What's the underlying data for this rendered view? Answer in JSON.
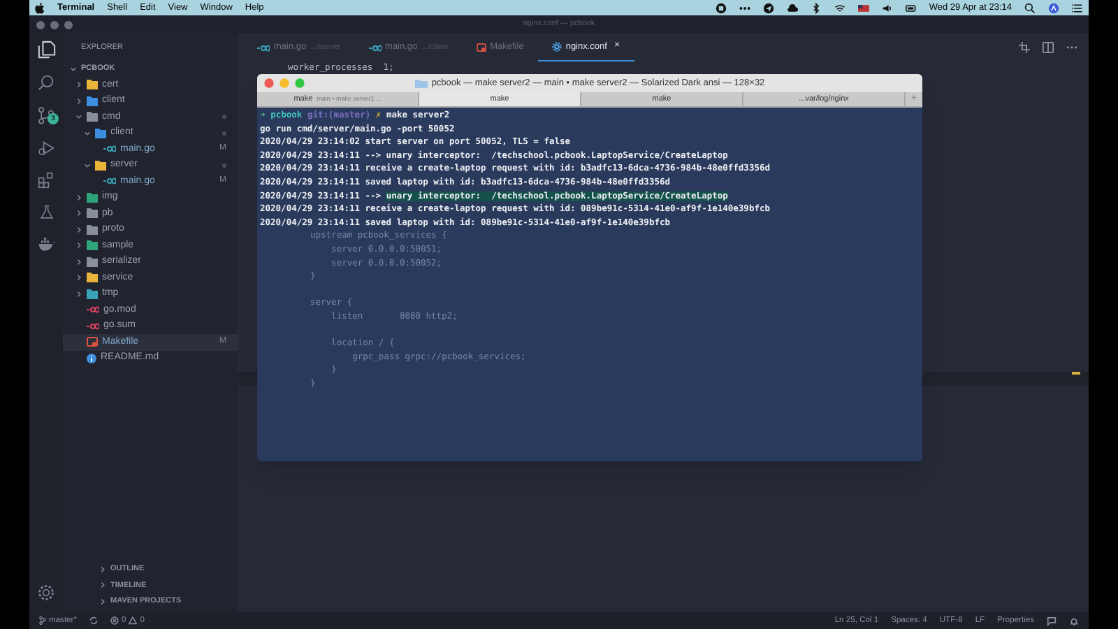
{
  "menu_bar": {
    "app": "Terminal",
    "items": [
      "Shell",
      "Edit",
      "View",
      "Window",
      "Help"
    ],
    "clock": "Wed 29 Apr at 23:14"
  },
  "window": {
    "title": "nginx.conf — pcbook"
  },
  "activity_bar": {
    "source_control_badge": "3"
  },
  "sidebar": {
    "title": "EXPLORER",
    "project": "PCBOOK",
    "tree": [
      {
        "label": "cert",
        "kind": "folder",
        "color": "#e8b43a",
        "expanded": false,
        "selected": false
      },
      {
        "label": "client",
        "kind": "folder",
        "color": "#3d8ee0",
        "expanded": false,
        "selected": false
      },
      {
        "label": "cmd",
        "kind": "folder",
        "color": "#8a8f9c",
        "expanded": true,
        "dot": true,
        "selected": false,
        "children": [
          {
            "label": "client",
            "kind": "folder",
            "color": "#3d8ee0",
            "expanded": true,
            "dot": true,
            "selected": false,
            "children": [
              {
                "label": "main.go",
                "kind": "go",
                "color": "#3aa3b8",
                "modified": "M",
                "selected": false
              }
            ]
          },
          {
            "label": "server",
            "kind": "folder",
            "color": "#e8b43a",
            "expanded": true,
            "dot": true,
            "selected": false,
            "children": [
              {
                "label": "main.go",
                "kind": "go",
                "color": "#3aa3b8",
                "modified": "M",
                "selected": false
              }
            ]
          }
        ]
      },
      {
        "label": "img",
        "kind": "folder",
        "color": "#2fa37a",
        "expanded": false,
        "selected": false
      },
      {
        "label": "pb",
        "kind": "folder",
        "color": "#8a8f9c",
        "expanded": false,
        "selected": false
      },
      {
        "label": "proto",
        "kind": "folder",
        "color": "#8a8f9c",
        "expanded": false,
        "selected": false
      },
      {
        "label": "sample",
        "kind": "folder",
        "color": "#2fa37a",
        "expanded": false,
        "selected": false
      },
      {
        "label": "serializer",
        "kind": "folder",
        "color": "#8a8f9c",
        "expanded": false,
        "selected": false
      },
      {
        "label": "service",
        "kind": "folder",
        "color": "#e8b43a",
        "expanded": false,
        "selected": false
      },
      {
        "label": "tmp",
        "kind": "folder",
        "color": "#3aa3b8",
        "expanded": false,
        "selected": false
      },
      {
        "label": "go.mod",
        "kind": "go",
        "color": "#d9465f",
        "selected": false
      },
      {
        "label": "go.sum",
        "kind": "go",
        "color": "#d9465f",
        "selected": false
      },
      {
        "label": "Makefile",
        "kind": "makefile",
        "color": "#e0523f",
        "modified": "M",
        "selected": true
      },
      {
        "label": "README.md",
        "kind": "info",
        "color": "#3d8ee0",
        "selected": false
      }
    ],
    "panels": [
      "OUTLINE",
      "TIMELINE",
      "MAVEN PROJECTS"
    ]
  },
  "editor_tabs": [
    {
      "label": "main.go",
      "hint": ".../server",
      "kind": "go",
      "selected": false
    },
    {
      "label": "main.go",
      "hint": ".../client",
      "kind": "go",
      "selected": false
    },
    {
      "label": "Makefile",
      "kind": "makefile",
      "selected": false
    },
    {
      "label": "nginx.conf",
      "kind": "gear",
      "selected": true,
      "close": "×"
    }
  ],
  "editor": {
    "lines": [
      "worker_processes  1;"
    ]
  },
  "terminal": {
    "title": "pcbook — make server2 — main • make server2 — Solarized Dark ansi — 128×32",
    "tabs": [
      {
        "label": "make",
        "hint": "main • make server1 ...",
        "selected": false
      },
      {
        "label": "make",
        "selected": true
      },
      {
        "label": "make",
        "selected": false
      },
      {
        "label": "...var/log/nginx",
        "selected": false
      }
    ],
    "new_tab": "+",
    "prompt": {
      "arrow": "➜",
      "dir": "pcbook",
      "git": "git:(master)",
      "dirty": "✗",
      "command": "make server2"
    },
    "lines": [
      {
        "text": "go run cmd/server/main.go -port 50052"
      },
      {
        "text": "2020/04/29 23:14:02 start server on port 50052, TLS = false"
      },
      {
        "text": "2020/04/29 23:14:11 --> unary interceptor:  /techschool.pcbook.LaptopService/CreateLaptop"
      },
      {
        "text": "2020/04/29 23:14:11 receive a create-laptop request with id: b3adfc13-6dca-4736-984b-48e0ffd3356d"
      },
      {
        "text": "2020/04/29 23:14:11 saved laptop with id: b3adfc13-6dca-4736-984b-48e0ffd3356d"
      },
      {
        "text": "2020/04/29 23:14:11 --> ",
        "selected_text": "unary interceptor:  /techschool.pcbook.LaptopService/CreateLaptop"
      },
      {
        "text": "2020/04/29 23:14:11 receive a create-laptop request with id: 089be91c-5314-41e0-af9f-1e140e39bfcb"
      },
      {
        "text": "2020/04/29 23:14:11 saved laptop with id: 089be91c-5314-41e0-af9f-1e140e39bfcb"
      }
    ],
    "behind_blocks": [
      [
        "upstream pcbook_services {",
        "    server 0.0.0.0:50051;",
        "    server 0.0.0.0:50052;",
        "}"
      ],
      [
        "server {",
        "    listen       8080 http2;"
      ],
      [
        "    location / {",
        "        grpc_pass grpc://pcbook_services;",
        "    }",
        "}"
      ]
    ]
  },
  "status_bar": {
    "branch": "master*",
    "errors": "0",
    "warnings": "0",
    "items": [
      "Ln 25, Col 1",
      "Spaces: 4",
      "UTF-8",
      "LF",
      "Properties"
    ]
  }
}
